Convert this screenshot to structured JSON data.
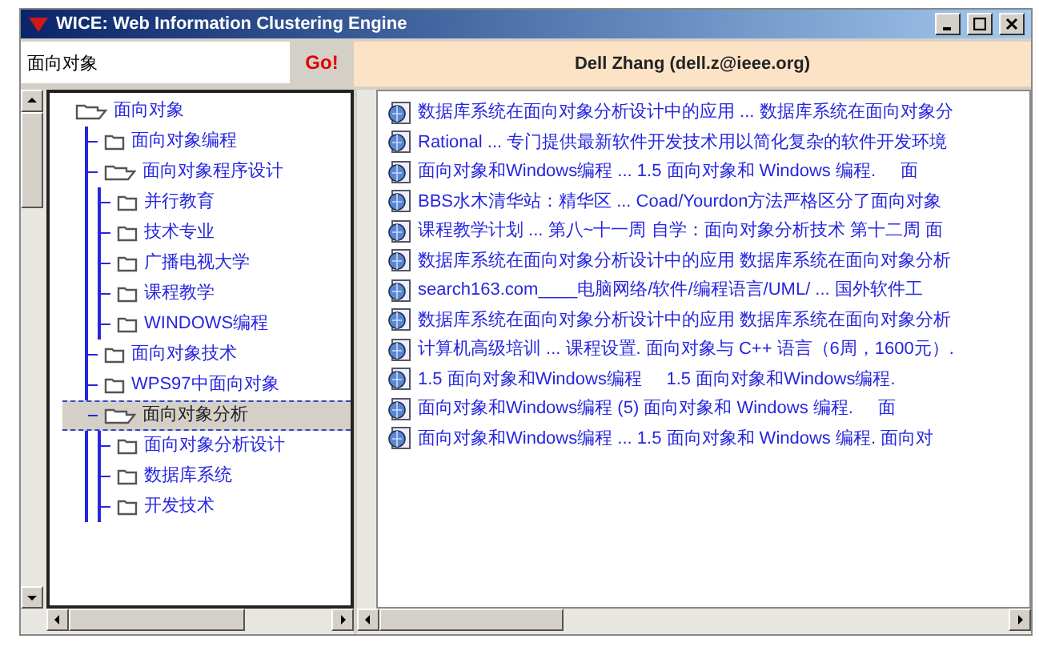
{
  "window": {
    "title": "WICE: Web Information Clustering Engine"
  },
  "search": {
    "value": "面向对象",
    "button": "Go!"
  },
  "header": {
    "text": "Dell Zhang (dell.z@ieee.org)"
  },
  "tree": [
    {
      "label": "面向对象",
      "expanded": true,
      "selected": false,
      "children": [
        {
          "label": "面向对象编程",
          "expanded": false,
          "selected": false
        },
        {
          "label": "面向对象程序设计",
          "expanded": true,
          "selected": false,
          "children": [
            {
              "label": "并行教育",
              "expanded": false,
              "selected": false
            },
            {
              "label": "技术专业",
              "expanded": false,
              "selected": false
            },
            {
              "label": "广播电视大学",
              "expanded": false,
              "selected": false
            },
            {
              "label": "课程教学",
              "expanded": false,
              "selected": false
            },
            {
              "label": "WINDOWS编程",
              "expanded": false,
              "selected": false
            }
          ]
        },
        {
          "label": "面向对象技术",
          "expanded": false,
          "selected": false
        },
        {
          "label": "WPS97中面向对象",
          "expanded": false,
          "selected": false
        },
        {
          "label": "面向对象分析",
          "expanded": true,
          "selected": true,
          "children": [
            {
              "label": "面向对象分析设计",
              "expanded": false,
              "selected": false
            },
            {
              "label": "数据库系统",
              "expanded": false,
              "selected": false
            },
            {
              "label": "开发技术",
              "expanded": false,
              "selected": false
            }
          ]
        }
      ]
    }
  ],
  "results": [
    "数据库系统在面向对象分析设计中的应用 ... 数据库系统在面向对象分",
    "Rational ... 专门提供最新软件开发技术用以简化复杂的软件开发环境",
    "面向对象和Windows编程 ... 1.5 面向对象和 Windows 编程.     面",
    "BBS水木清华站：精华区 ... Coad/Yourdon方法严格区分了面向对象",
    "课程教学计划 ... 第八~十一周 自学：面向对象分析技术 第十二周 面",
    "数据库系统在面向对象分析设计中的应用 数据库系统在面向对象分析",
    "search163.com____电脑网络/软件/编程语言/UML/ ... 国外软件工",
    "数据库系统在面向对象分析设计中的应用 数据库系统在面向对象分析",
    "计算机高级培训 ... 课程设置. 面向对象与 C++ 语言（6周，1600元）.",
    "1.5 面向对象和Windows编程     1.5 面向对象和Windows编程.",
    "面向对象和Windows编程 (5) 面向对象和 Windows 编程.     面",
    "面向对象和Windows编程 ... 1.5 面向对象和 Windows 编程. 面向对"
  ]
}
